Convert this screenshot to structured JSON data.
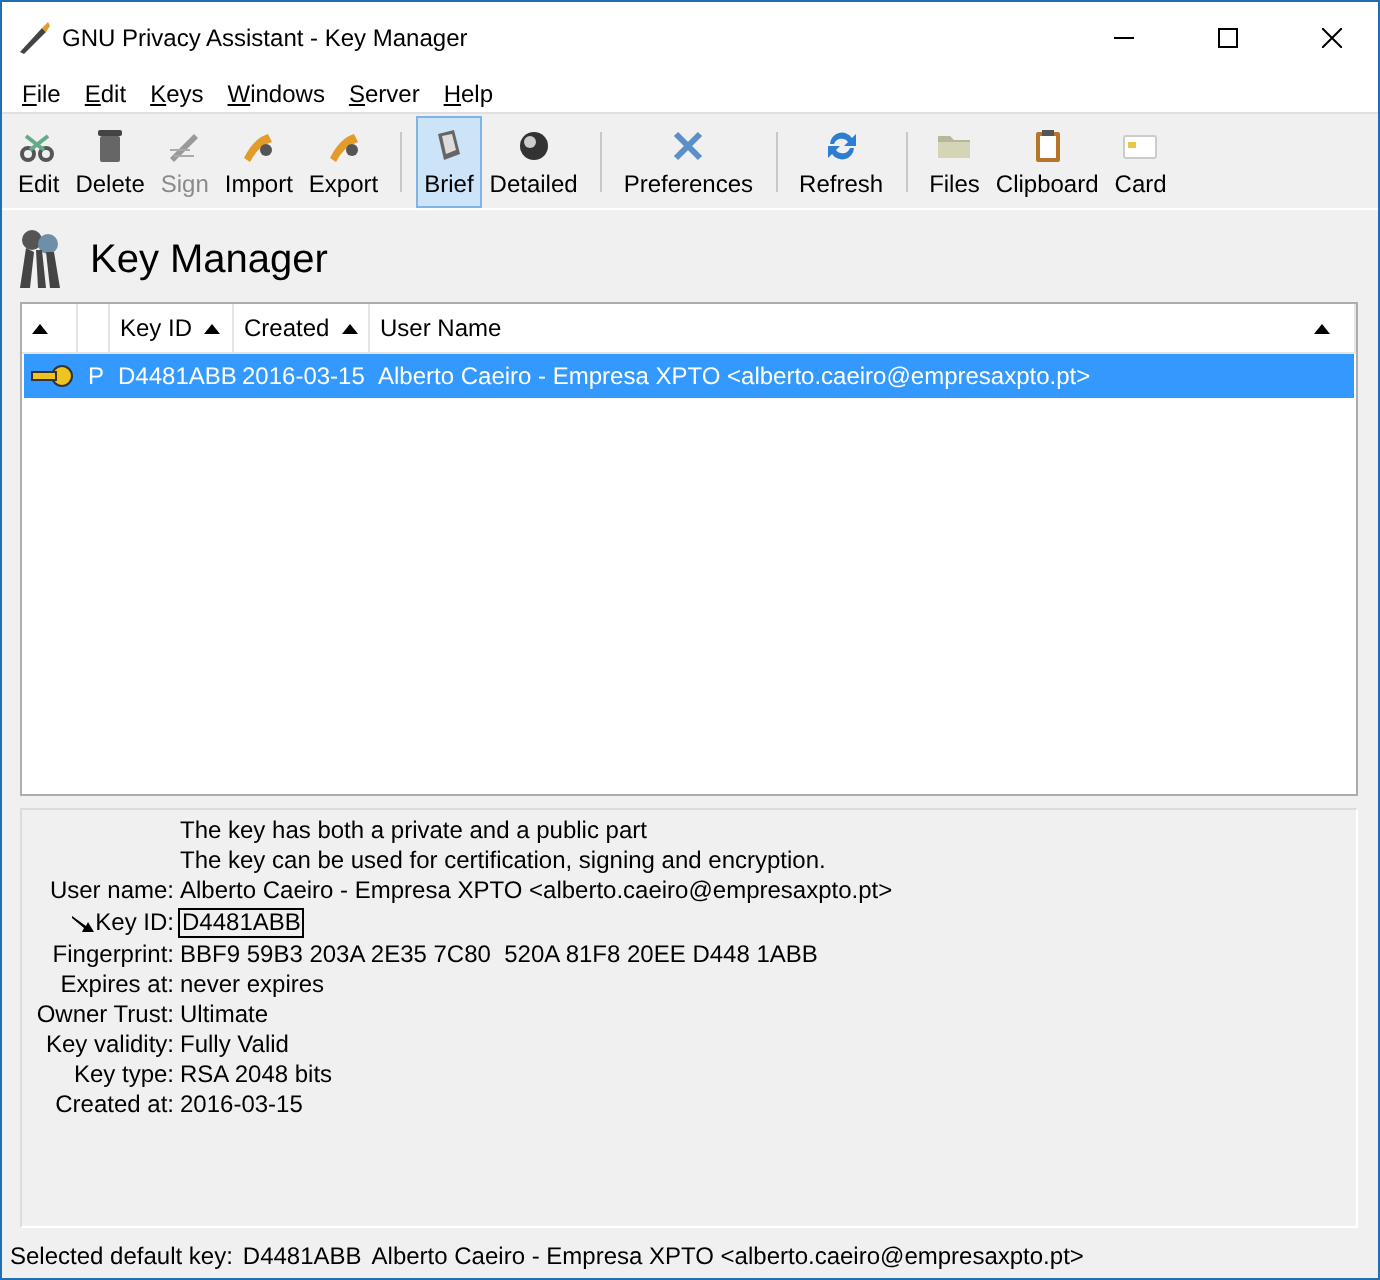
{
  "window": {
    "title": "GNU Privacy Assistant - Key Manager"
  },
  "menu": [
    "File",
    "Edit",
    "Keys",
    "Windows",
    "Server",
    "Help"
  ],
  "toolbar": [
    {
      "label": "Edit",
      "kind": "edit",
      "disabled": false,
      "selected": false
    },
    {
      "label": "Delete",
      "kind": "delete",
      "disabled": false,
      "selected": false
    },
    {
      "label": "Sign",
      "kind": "sign",
      "disabled": true,
      "selected": false
    },
    {
      "label": "Import",
      "kind": "import",
      "disabled": false,
      "selected": false
    },
    {
      "label": "Export",
      "kind": "export",
      "disabled": false,
      "selected": false,
      "separator_after": true
    },
    {
      "label": "Brief",
      "kind": "brief",
      "disabled": false,
      "selected": true
    },
    {
      "label": "Detailed",
      "kind": "detailed",
      "disabled": false,
      "selected": false,
      "separator_after": true
    },
    {
      "label": "Preferences",
      "kind": "preferences",
      "disabled": false,
      "selected": false,
      "separator_after": true
    },
    {
      "label": "Refresh",
      "kind": "refresh",
      "disabled": false,
      "selected": false,
      "separator_after": true
    },
    {
      "label": "Files",
      "kind": "files",
      "disabled": false,
      "selected": false
    },
    {
      "label": "Clipboard",
      "kind": "clipboard",
      "disabled": false,
      "selected": false
    },
    {
      "label": "Card",
      "kind": "card",
      "disabled": false,
      "selected": false
    }
  ],
  "heading": "Key Manager",
  "table": {
    "columns": [
      {
        "sort": true
      },
      {
        "sort": false
      },
      {
        "label": "Key ID",
        "sort": true
      },
      {
        "label": "Created",
        "sort": true
      },
      {
        "label": "User Name",
        "sort": true
      }
    ],
    "rows": [
      {
        "type": "P",
        "key_id": "D4481ABB",
        "created": "2016-03-15",
        "user_name": "Alberto Caeiro - Empresa XPTO <alberto.caeiro@empresaxpto.pt>",
        "selected": true
      }
    ]
  },
  "details": {
    "notes": [
      "The key has both a private and a public part",
      "The key can be used for certification, signing and encryption."
    ],
    "fields": [
      {
        "label": "User name:",
        "value": "Alberto Caeiro - Empresa XPTO <alberto.caeiro@empresaxpto.pt>"
      },
      {
        "label": "Key ID:",
        "value": "D4481ABB",
        "kind": "keyid"
      },
      {
        "label": "Fingerprint:",
        "value": "BBF9 59B3 203A 2E35 7C80  520A 81F8 20EE D448 1ABB"
      },
      {
        "label": "Expires at:",
        "value": "never expires"
      },
      {
        "label": "Owner Trust:",
        "value": "Ultimate"
      },
      {
        "label": "Key validity:",
        "value": "Fully Valid"
      },
      {
        "label": "Key type:",
        "value": "RSA 2048 bits"
      },
      {
        "label": "Created at:",
        "value": "2016-03-15"
      }
    ]
  },
  "status_bar": {
    "label": "Selected default key:",
    "key_id": "D4481ABB",
    "user_name": "Alberto Caeiro - Empresa XPTO <alberto.caeiro@empresaxpto.pt>"
  }
}
